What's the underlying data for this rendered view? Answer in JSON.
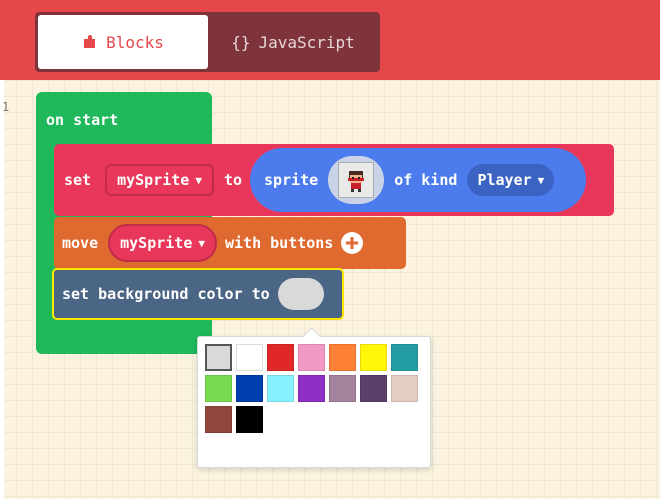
{
  "tabs": {
    "blocks_label": "Blocks",
    "javascript_icon": "{}",
    "javascript_label": "JavaScript"
  },
  "workspace": {
    "left_marker": "1"
  },
  "blocks": {
    "on_start_label": "on start",
    "set_label": "set",
    "sprite_var": "mySprite",
    "to_label": "to",
    "sprite_label": "sprite",
    "of_kind_label": "of kind",
    "kind_value": "Player",
    "move_label": "move",
    "move_var": "mySprite",
    "with_buttons_label": "with buttons",
    "set_bg_label": "set background color to"
  },
  "palette": {
    "colors": [
      "#d9d9d9",
      "#ffffff",
      "#e02828",
      "#f29ac5",
      "#ff8135",
      "#fff609",
      "#249ca3",
      "#78dc52",
      "#003fad",
      "#87f2ff",
      "#8e2ec4",
      "#a4839f",
      "#5c406c",
      "#e5cdc4",
      "#91463d",
      "#000000"
    ]
  },
  "colors": {
    "header": "#e6474b",
    "events_green": "#1fb85b",
    "sprites_red": "#e8375a",
    "sprites_blue": "#4b7bec",
    "controller_orange": "#df6a2f",
    "scene_slate": "#4b6584",
    "highlight_yellow": "#ffe600"
  }
}
